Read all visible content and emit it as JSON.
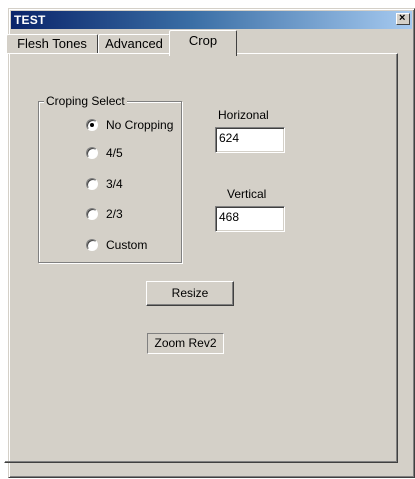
{
  "window": {
    "title": "TEST",
    "close_glyph": "×"
  },
  "tabs": [
    {
      "label": "Flesh Tones",
      "active": false
    },
    {
      "label": "Advanced",
      "active": false
    },
    {
      "label": "Crop",
      "active": true
    }
  ],
  "crop": {
    "group_label": "Croping Select",
    "options": [
      {
        "label": "No Cropping",
        "selected": true
      },
      {
        "label": "4/5",
        "selected": false
      },
      {
        "label": "3/4",
        "selected": false
      },
      {
        "label": "2/3",
        "selected": false
      },
      {
        "label": "Custom",
        "selected": false
      }
    ],
    "horizontal_label": "Horizonal",
    "horizontal_value": "624",
    "vertical_label": "Vertical",
    "vertical_value": "468",
    "resize_label": "Resize",
    "zoom_label": "Zoom Rev2"
  },
  "colors": {
    "face": "#d4d0c8",
    "title_start": "#0a246a",
    "title_end": "#a6caf0"
  }
}
